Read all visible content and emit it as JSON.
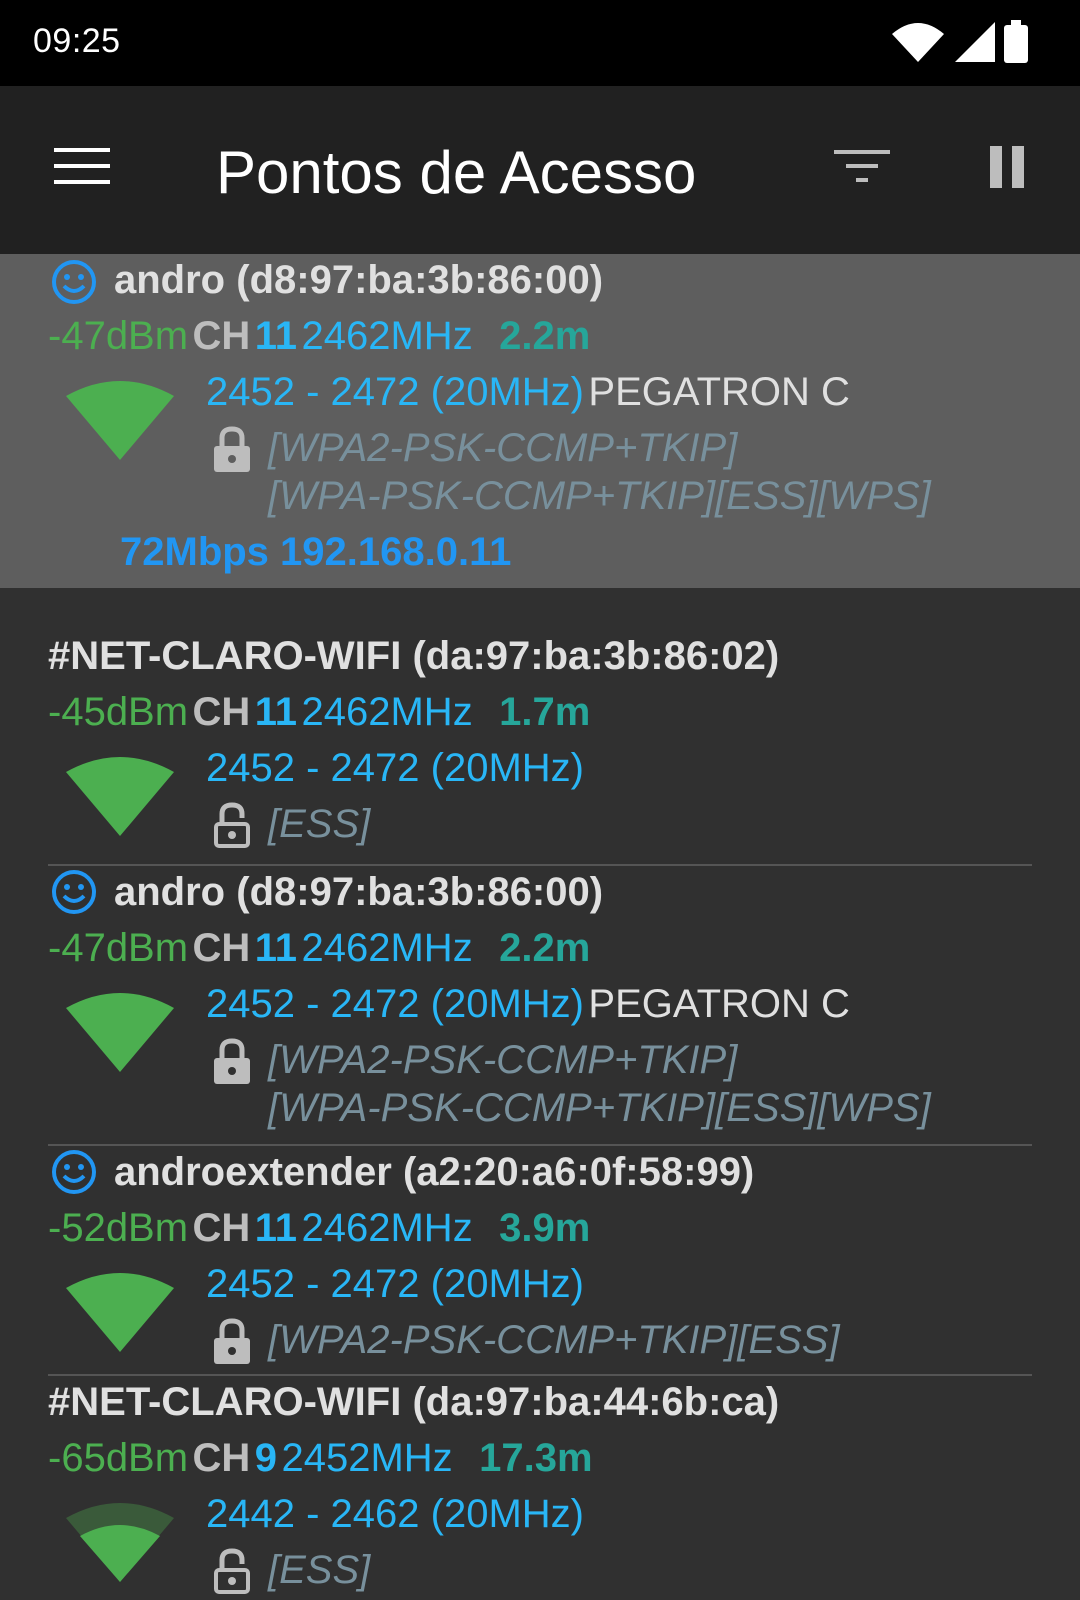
{
  "status_bar": {
    "time": "09:25",
    "icons": [
      "wifi-icon",
      "cellular-signal-icon",
      "battery-icon"
    ]
  },
  "app_bar": {
    "title": "Pontos de Acesso",
    "icons": [
      "menu-icon",
      "filter-icon",
      "pause-icon"
    ]
  },
  "colors": {
    "signal_green": "#4caf50",
    "channel_blue": "#29b6f6",
    "distance_teal": "#26a69a",
    "speed_blue": "#2196f3",
    "security_gray": "#78909c",
    "connected_face": "#2196f3"
  },
  "access_points": [
    {
      "ssid": "andro",
      "mac": "(d8:97:ba:3b:86:00)",
      "connected_icon": true,
      "dbm": "-47dBm",
      "ch_label": "CH",
      "channel": "11",
      "freq": "2462MHz",
      "distance": "2.2m",
      "range": "2452 - 2472 (20MHz)",
      "vendor": "PEGATRON C",
      "security_line1": "[WPA2-PSK-CCMP+TKIP]",
      "security_line2": "[WPA-PSK-CCMP+TKIP][ESS][WPS]",
      "speed_ip": "72Mbps 192.168.0.11"
    },
    {
      "ssid": "#NET-CLARO-WIFI",
      "mac": "(da:97:ba:3b:86:02)",
      "connected_icon": false,
      "dbm": "-45dBm",
      "ch_label": "CH",
      "channel": "11",
      "freq": "2462MHz",
      "distance": "1.7m",
      "range": "2452 - 2472 (20MHz)",
      "vendor": "",
      "security_line1": "[ESS]",
      "lock": "open"
    },
    {
      "ssid": "andro",
      "mac": "(d8:97:ba:3b:86:00)",
      "connected_icon": true,
      "dbm": "-47dBm",
      "ch_label": "CH",
      "channel": "11",
      "freq": "2462MHz",
      "distance": "2.2m",
      "range": "2452 - 2472 (20MHz)",
      "vendor": "PEGATRON C",
      "security_line1": "[WPA2-PSK-CCMP+TKIP]",
      "security_line2": "[WPA-PSK-CCMP+TKIP][ESS][WPS]"
    },
    {
      "ssid": "androextender",
      "mac": "(a2:20:a6:0f:58:99)",
      "connected_icon": true,
      "dbm": "-52dBm",
      "ch_label": "CH",
      "channel": "11",
      "freq": "2462MHz",
      "distance": "3.9m",
      "range": "2452 - 2472 (20MHz)",
      "vendor": "",
      "security_line1": "[WPA2-PSK-CCMP+TKIP][ESS]"
    },
    {
      "ssid": "#NET-CLARO-WIFI",
      "mac": "(da:97:ba:44:6b:ca)",
      "connected_icon": false,
      "dbm": "-65dBm",
      "ch_label": "CH",
      "channel": "9",
      "freq": "2452MHz",
      "distance": "17.3m",
      "range": "2442 - 2462 (20MHz)",
      "vendor": "",
      "security_line1": "[ESS]",
      "lock": "open"
    }
  ]
}
